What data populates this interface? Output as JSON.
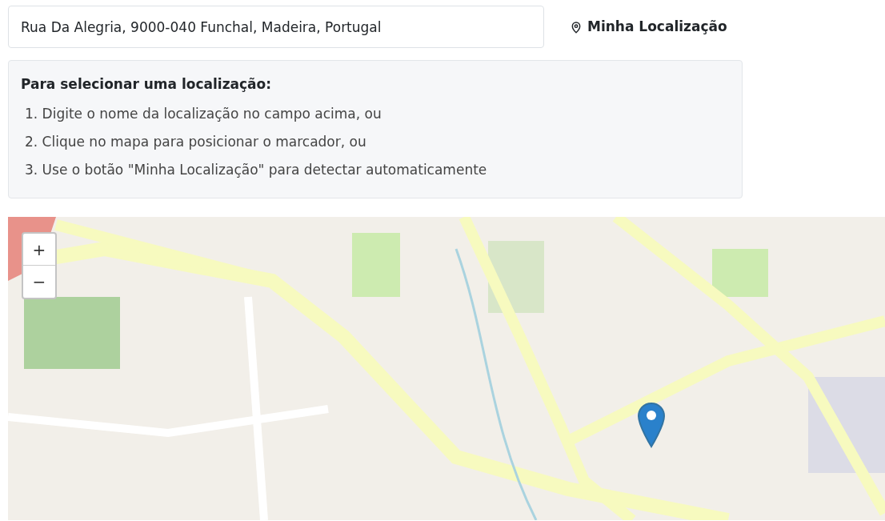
{
  "location_field": {
    "value": "Rua Da Alegria, 9000-040 Funchal, Madeira, Portugal"
  },
  "locate_button": {
    "label": "Minha Localização"
  },
  "instructions": {
    "title": "Para selecionar uma localização:",
    "steps": [
      "1. Digite o nome da localização no campo acima, ou",
      "2. Clique no mapa para posicionar o marcador, ou",
      "3. Use o botão \"Minha Localização\" para detectar automaticamente"
    ]
  },
  "map": {
    "kind": "picture",
    "zoom_controls": [
      "+",
      "−"
    ]
  }
}
